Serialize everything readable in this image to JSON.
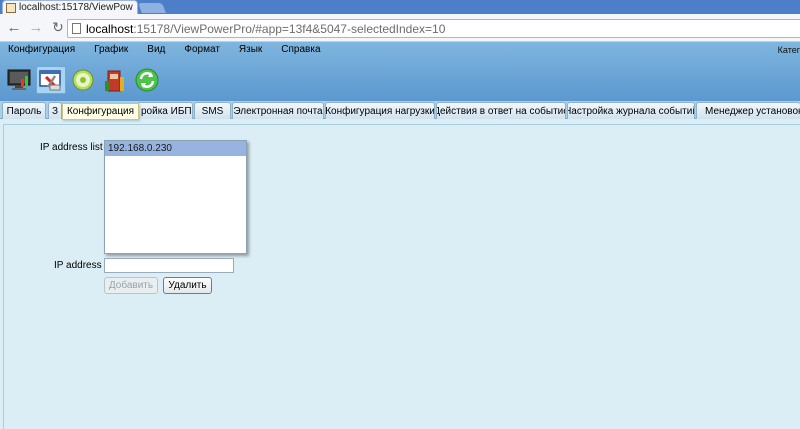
{
  "browser": {
    "tab_title": "localhost:15178/ViewPow",
    "url_host": "localhost",
    "url_rest": ":15178/ViewPowerPro/#app=13f4&5047-selectedIndex=10"
  },
  "menu": [
    "Конфигурация",
    "График",
    "Вид",
    "Формат",
    "Язык",
    "Справка"
  ],
  "category_label": "Катег",
  "toolbar_icons": [
    "monitor-icon",
    "config-tools-icon",
    "disc-icon",
    "ups-chart-icon",
    "refresh-icon"
  ],
  "tabs": [
    {
      "label": "Пароль"
    },
    {
      "label": "З"
    },
    {
      "label": "ройка ИБП"
    },
    {
      "label": "SMS"
    },
    {
      "label": "Электронная почта"
    },
    {
      "label": "Конфигурация нагрузки"
    },
    {
      "label": "Действия в ответ на событие"
    },
    {
      "label": "Настройка журнала событий"
    },
    {
      "label": "Менеджер установок EM"
    }
  ],
  "tooltip": "Конфигурация",
  "form": {
    "ip_list_label": "IP address list",
    "ip_list": [
      "192.168.0.230"
    ],
    "ip_label": "IP address",
    "ip_value": "",
    "add_button": "Добавить",
    "delete_button": "Удалить"
  }
}
